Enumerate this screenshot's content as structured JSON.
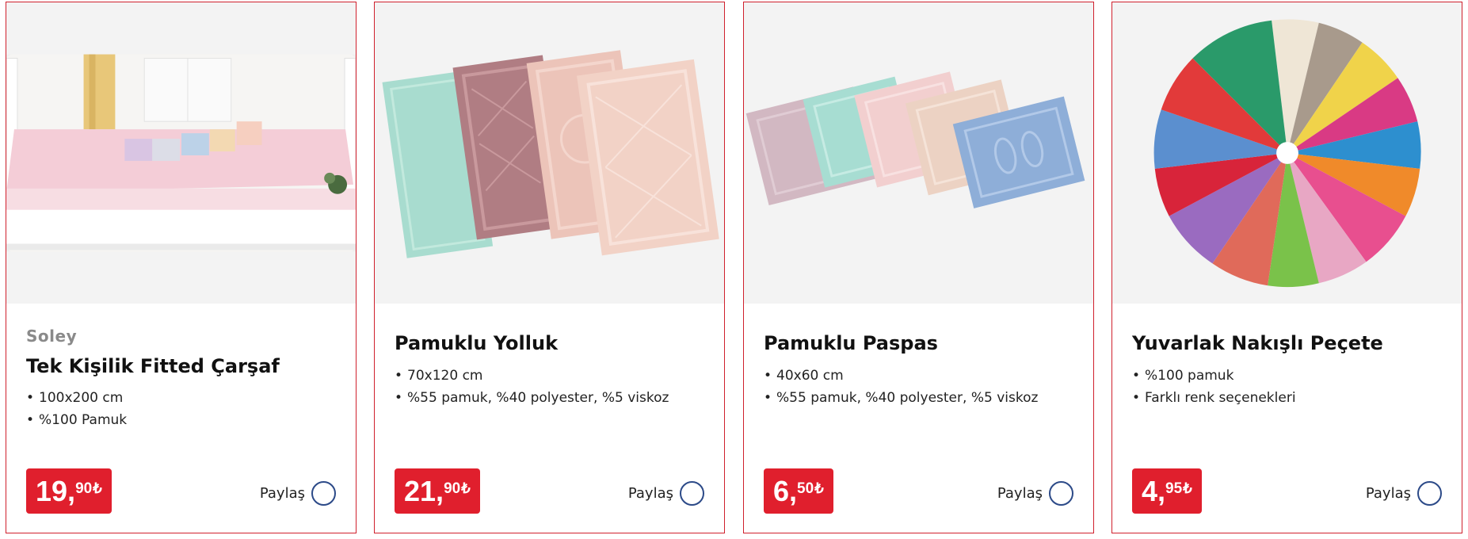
{
  "products": [
    {
      "brand": "Soley",
      "title": "Tek Kişilik Fitted Çarşaf",
      "features": [
        "100x200 cm",
        "%100 Pamuk"
      ],
      "price": {
        "whole": "19",
        "separator": ",",
        "fraction": "90",
        "currency": "₺"
      },
      "share_label": "Paylaş",
      "image_icon": "fitted-sheet-photo"
    },
    {
      "brand": "",
      "title": "Pamuklu Yolluk",
      "features": [
        "70x120 cm",
        "%55 pamuk, %40 polyester, %5 viskoz"
      ],
      "price": {
        "whole": "21",
        "separator": ",",
        "fraction": "90",
        "currency": "₺"
      },
      "share_label": "Paylaş",
      "image_icon": "runner-rugs-photo"
    },
    {
      "brand": "",
      "title": "Pamuklu Paspas",
      "features": [
        "40x60 cm",
        "%55 pamuk, %40 polyester, %5 viskoz"
      ],
      "price": {
        "whole": "6",
        "separator": ",",
        "fraction": "50",
        "currency": "₺"
      },
      "share_label": "Paylaş",
      "image_icon": "bath-mats-photo"
    },
    {
      "brand": "",
      "title": "Yuvarlak Nakışlı Peçete",
      "features": [
        "%100 pamuk",
        "Farklı renk seçenekleri"
      ],
      "price": {
        "whole": "4",
        "separator": ",",
        "fraction": "95",
        "currency": "₺"
      },
      "share_label": "Paylaş",
      "image_icon": "napkins-photo"
    }
  ],
  "colors": {
    "accent": "#e01f2d",
    "card_border": "#d0202d",
    "share_icon": "#2c4a88",
    "image_bg": "#f3f3f3"
  }
}
